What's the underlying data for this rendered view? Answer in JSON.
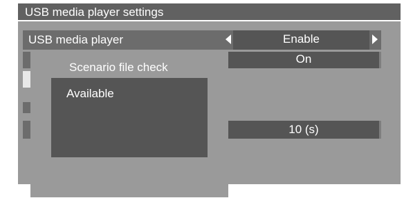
{
  "window": {
    "title": "USB media player settings"
  },
  "settings": {
    "usb_media_player": {
      "label": "USB media player",
      "value": "Enable"
    },
    "scenario_row_value": "On",
    "time_row_value": "10 (s)"
  },
  "dialog": {
    "title": "Scenario file check",
    "status": "Available"
  },
  "icons": {
    "left": "triangle-left-icon",
    "right": "triangle-right-icon"
  },
  "colors": {
    "panel": "#9a9a9a",
    "title_bar": "#616161",
    "selected_row": "#6c6c6c",
    "value_box": "#555555",
    "text": "#ffffff"
  }
}
